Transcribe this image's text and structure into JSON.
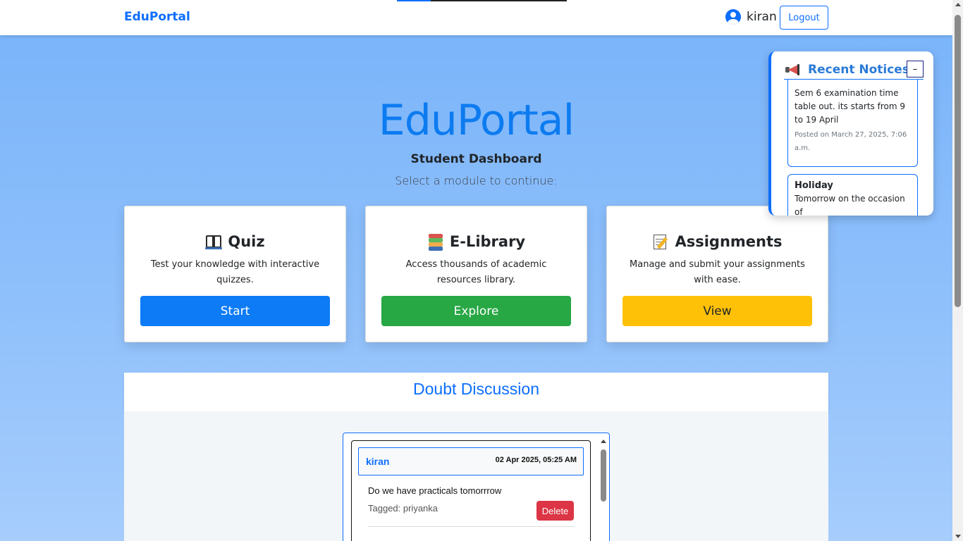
{
  "navbar": {
    "brand": "EduPortal",
    "username": "kiran",
    "logout_label": "Logout"
  },
  "hero": {
    "title": "EduPortal",
    "subtitle": "Student Dashboard",
    "lead": "Select a module to continue:"
  },
  "modules": [
    {
      "icon": "open-book-icon",
      "title": "Quiz",
      "description": "Test your knowledge with interactive quizzes.",
      "button": "Start",
      "color": "#0d7bf5"
    },
    {
      "icon": "books-icon",
      "title": "E-Library",
      "description": "Access thousands of academic resources library.",
      "button": "Explore",
      "color": "#28a745"
    },
    {
      "icon": "memo-icon",
      "title": "Assignments",
      "description": "Manage and submit your assignments with ease.",
      "button": "View",
      "color": "#ffc107"
    }
  ],
  "doubts": {
    "title": "Doubt Discussion",
    "messages": [
      {
        "user": "kiran",
        "time": "02 Apr 2025, 05:25 AM",
        "text": "Do we have practicals tomorrrow",
        "tagged": "Tagged: priyanka",
        "delete_label": "Delete"
      }
    ]
  },
  "notices": {
    "title": "Recent Notices",
    "minimize_label": "–",
    "items": [
      {
        "title": "",
        "body": "Sem 6 examination time table out. its starts from 9 to 19 April",
        "posted": "Posted on March 27, 2025, 7:06 a.m."
      },
      {
        "title": "Holiday",
        "body": "Tomorrow on the occasion of",
        "posted": ""
      }
    ]
  },
  "colors": {
    "primary": "#0d6efd",
    "danger": "#dc3545",
    "success": "#28a745",
    "warning": "#ffc107"
  }
}
